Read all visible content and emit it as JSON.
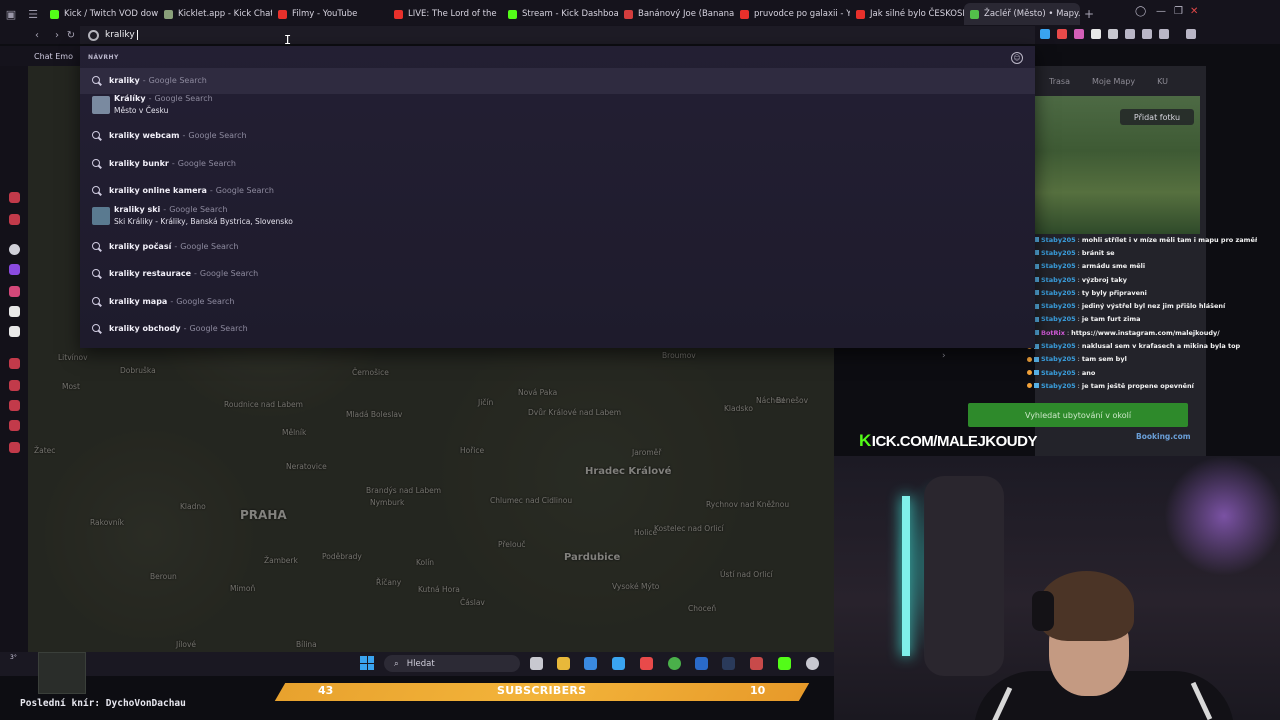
{
  "tabs": [
    {
      "label": "Kick / Twitch VOD downl",
      "color": "#53fc18"
    },
    {
      "label": "Kicklet.app - Kick Chatb",
      "color": "#8aa07a"
    },
    {
      "label": "Filmy - YouTube",
      "color": "#e8302b"
    },
    {
      "label": "LIVE: The Lord of the",
      "color": "#e8302b"
    },
    {
      "label": "Stream - Kick Dashboard",
      "color": "#53fc18"
    },
    {
      "label": "Banánový Joe (Banana",
      "color": "#d43d3d"
    },
    {
      "label": "pruvodce po galaxii - Yo",
      "color": "#e8302b"
    },
    {
      "label": "Jak silné bylo ČESKOSL",
      "color": "#e8302b"
    },
    {
      "label": "Žacléř (Město) • Mapy.co",
      "color": "#53c04a"
    }
  ],
  "omnibox": {
    "query": "kraliky"
  },
  "bookmarks": {
    "first": "Chat Emo"
  },
  "dropdown": {
    "header": "NÁVRHY",
    "suggestions": [
      {
        "text": "kraliky",
        "source": "Google Search"
      },
      {
        "text": "Králíky",
        "source": "Google Search",
        "subtitle": "Město v Česku"
      },
      {
        "text": "kraliky webcam",
        "source": "Google Search"
      },
      {
        "text": "kraliky bunkr",
        "source": "Google Search"
      },
      {
        "text": "kraliky online kamera",
        "source": "Google Search"
      },
      {
        "text": "kraliky ski",
        "source": "Google Search",
        "subtitle": "Ski Králiky - Králiky, Banská Bystrica, Slovensko"
      },
      {
        "text": "kraliky počasí",
        "source": "Google Search"
      },
      {
        "text": "kraliky restaurace",
        "source": "Google Search"
      },
      {
        "text": "kraliky mapa",
        "source": "Google Search"
      },
      {
        "text": "kraliky obchody",
        "source": "Google Search"
      }
    ]
  },
  "map": {
    "labels": [
      "Most",
      "Žatec",
      "Litvínov",
      "Roudnice nad Labem",
      "Mladá Boleslav",
      "Mělník",
      "Neratovice",
      "Brandýs nad Labem",
      "Kladno",
      "Rakovník",
      "Beroun",
      "Jičín",
      "Nová Paka",
      "Dvůr Králové nad Labem",
      "Náchod",
      "Hořice",
      "Jaroměř",
      "Broumov",
      "Poděbrady",
      "Nymburk",
      "Kolín",
      "Chlumec nad Cidlinou",
      "Kutná Hora",
      "Čáslav",
      "Přelouč",
      "Holice",
      "Kostelec nad Orlicí",
      "Rychnov nad Kněžnou",
      "Vysoké Mýto",
      "Choceň",
      "Ústí nad Orlicí",
      "Žamberk",
      "Říčany",
      "Benešov",
      "Kladsko",
      "Dobruška",
      "Mimoň",
      "Bílina",
      "Černošice",
      "Jílové",
      "Kralupy nad Vltavou"
    ],
    "cities": [
      "Hradec Králové",
      "Pardubice"
    ],
    "capital": "PRAHA"
  },
  "mapy_panel": {
    "route": "Trasa",
    "my_maps": "Moje Mapy",
    "user": "KU",
    "add_photo": "Přidat fotku",
    "booking_button": "Vyhledat ubytování v okolí",
    "booking_link": "Booking.com"
  },
  "chat": [
    {
      "user": "Staby205",
      "msg": "mohli střílet i v míze měli tam i mapu pro zaměření"
    },
    {
      "user": "Staby205",
      "msg": "bránit se"
    },
    {
      "user": "Staby205",
      "msg": "armádu sme měli"
    },
    {
      "user": "Staby205",
      "msg": "výzbroj taky"
    },
    {
      "user": "Staby205",
      "msg": "ty byly připraveni"
    },
    {
      "user": "Staby205",
      "msg": "jediný výstřel byl nez jim přišlo hlášení"
    },
    {
      "user": "Staby205",
      "msg": "je tam furt zima"
    },
    {
      "user": "BotRix",
      "msg": "https://www.instagram.com/malejkoudy/",
      "bot": true
    },
    {
      "user": "Staby205",
      "msg": "naklusal sem v krafasech a mikina byla top"
    },
    {
      "user": "Staby205",
      "msg": "tam sem byl"
    },
    {
      "user": "Staby205",
      "msg": "ano"
    },
    {
      "user": "Staby205",
      "msg": "je tam ještě propene opevnění"
    }
  ],
  "overlay": {
    "kick_prefix": "K",
    "kick_url": "ICK.COM/MALEJKOUDY",
    "last_sub": "Poslední knír: DychoVonDachau",
    "sub_left": "43",
    "sub_label": "SUBSCRIBERS",
    "sub_right": "10"
  },
  "taskbar": {
    "search_placeholder": "Hledat",
    "weather": "3°"
  }
}
